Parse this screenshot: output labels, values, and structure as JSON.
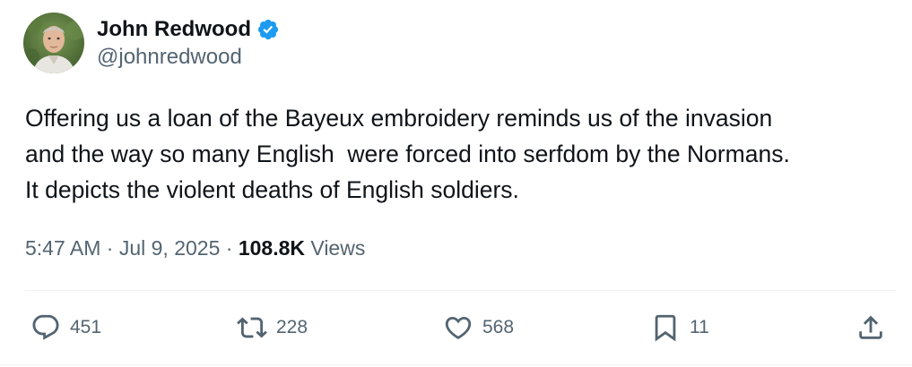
{
  "author": {
    "display_name": "John Redwood",
    "handle": "@johnredwood",
    "verified": true,
    "verified_color": "#1d9bf0"
  },
  "tweet": {
    "text": "Offering us a loan of the Bayeux embroidery reminds us of the invasion\nand the way so many English  were forced into serfdom by the Normans.\nIt depicts the violent deaths of English soldiers.",
    "time": "5:47 AM",
    "separator": " · ",
    "date": "Jul 9, 2025",
    "views_count": "108.8K",
    "views_label": " Views"
  },
  "actions": {
    "reply": {
      "icon": "reply-icon",
      "count": "451"
    },
    "repost": {
      "icon": "repost-icon",
      "count": "228"
    },
    "like": {
      "icon": "heart-icon",
      "count": "568"
    },
    "bookmark": {
      "icon": "bookmark-icon",
      "count": "11"
    },
    "share": {
      "icon": "share-icon"
    }
  },
  "colors": {
    "text_primary": "#0f1419",
    "text_secondary": "#536471",
    "divider": "#eff3f4"
  }
}
